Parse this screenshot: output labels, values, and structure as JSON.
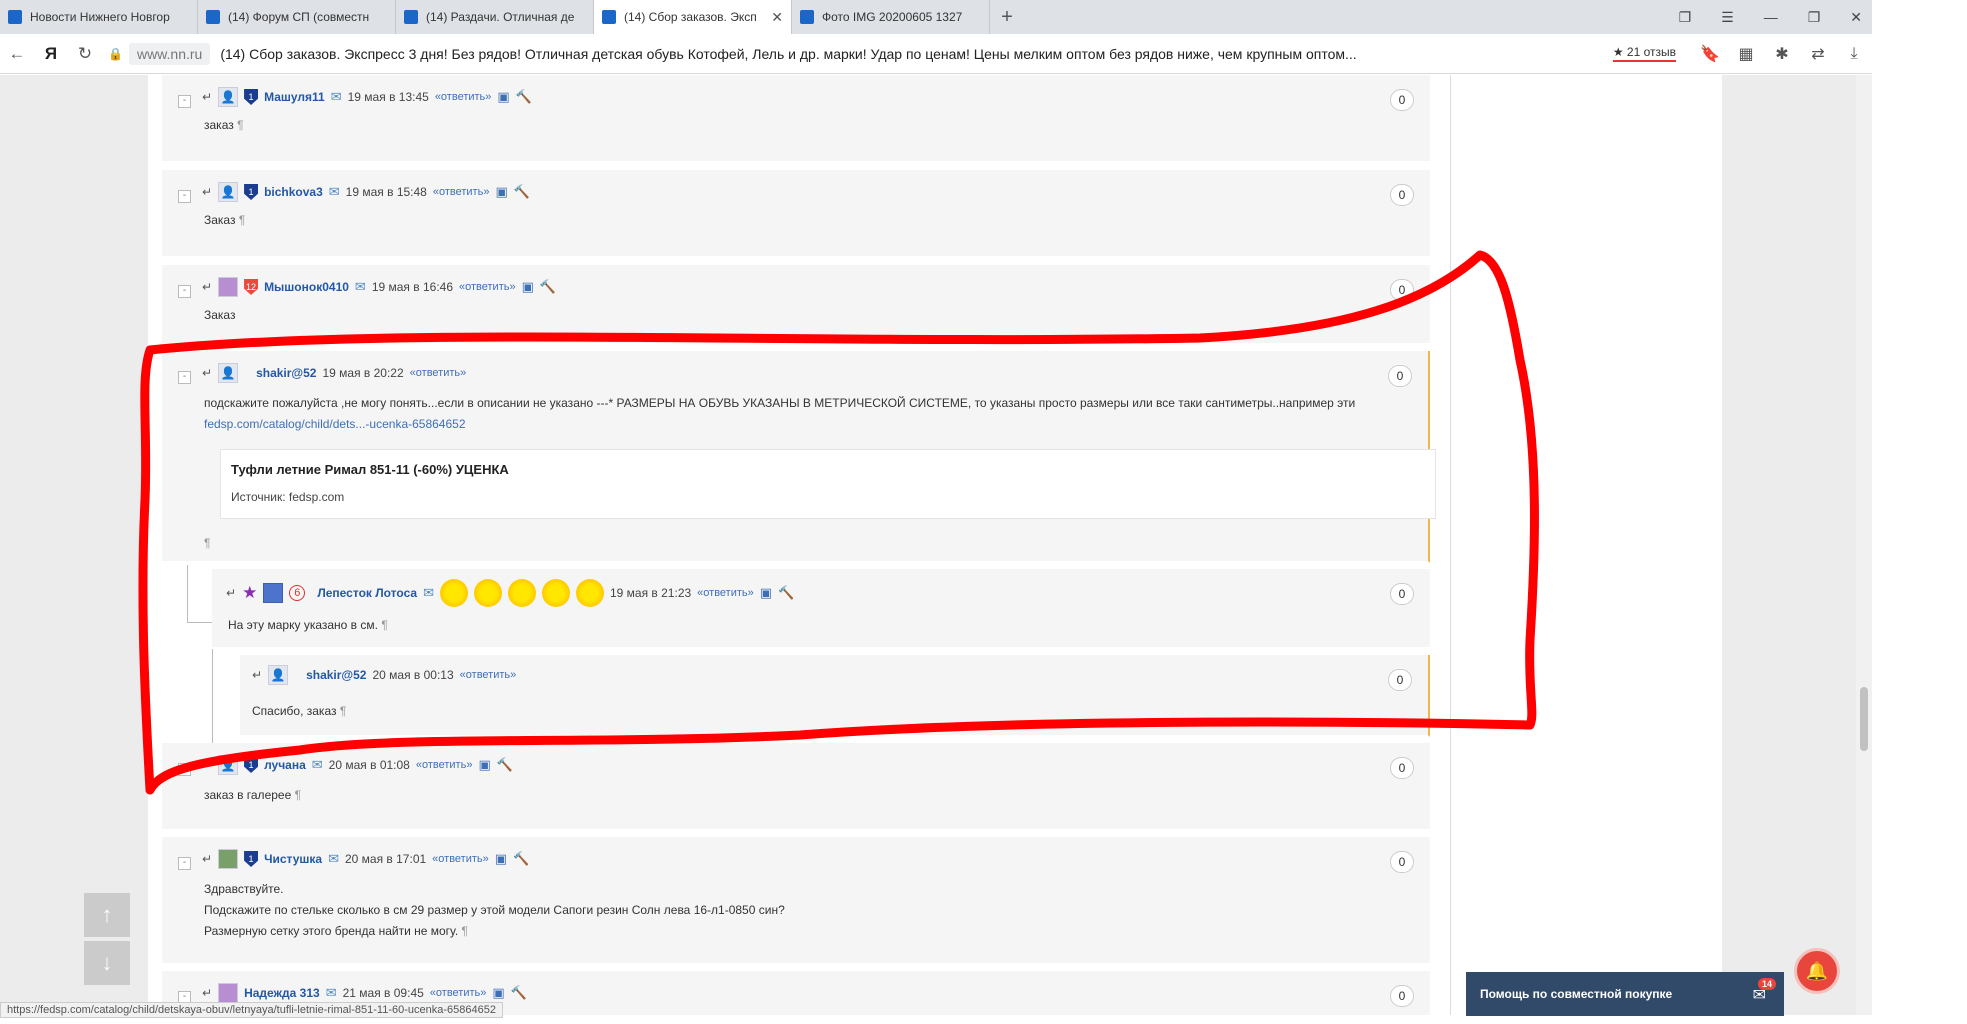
{
  "tabs": [
    {
      "title": "Новости Нижнего Новгор",
      "active": false
    },
    {
      "title": "(14) Форум СП (совместн",
      "active": false
    },
    {
      "title": "(14) Раздачи. Отличная де",
      "active": false
    },
    {
      "title": "(14) Сбор заказов. Эксп",
      "active": true
    },
    {
      "title": "Фото IMG 20200605 1327",
      "active": false
    }
  ],
  "address": {
    "domain": "www.nn.ru",
    "page_title": "(14) Сбор заказов. Экспресс 3 дня! Без рядов! Отличная детская обувь Котофей, Лель и др. марки! Удар по ценам! Цены мелким оптом без рядов ниже, чем крупным оптом...",
    "reviews": "21 отзыв"
  },
  "comments": [
    {
      "user": "Машуля11",
      "date": "19 мая в 13:45",
      "reply": "«ответить»",
      "text": "заказ",
      "votes": "0"
    },
    {
      "user": "bichkova3",
      "date": "19 мая в 15:48",
      "reply": "«ответить»",
      "text": "Заказ",
      "votes": "0"
    },
    {
      "user": "Мышонок0410",
      "date": "19 мая в 16:46",
      "reply": "«ответить»",
      "text": "Заказ",
      "votes": "0"
    },
    {
      "user": "shakir@52",
      "date": "19 мая в 20:22",
      "reply": "«ответить»",
      "text": "подскажите пожалуйста ,не могу понять...если в описании не указано ---* РАЗМЕРЫ НА ОБУВЬ УКАЗАНЫ В МЕТРИЧЕСКОЙ СИСТЕМЕ, то указаны просто размеры или все таки сантиметры..например эти",
      "link": "fedsp.com/catalog/child/dets...-ucenka-65864652",
      "preview_title": "Туфли летние Римал 851-11 (-60%) УЦЕНКА",
      "preview_source": "Источник: fedsp.com",
      "votes": "0"
    },
    {
      "user": "Лепесток Лотоса",
      "date": "19 мая в 21:23",
      "reply": "«ответить»",
      "rank": "6",
      "text": "На эту марку указано в см.",
      "votes": "0"
    },
    {
      "user": "shakir@52",
      "date": "20 мая в 00:13",
      "reply": "«ответить»",
      "text": "Спасибо, заказ",
      "votes": "0"
    },
    {
      "user": "лучана",
      "date": "20 мая в 01:08",
      "reply": "«ответить»",
      "text": "заказ в галерее",
      "votes": "0"
    },
    {
      "user": "Чистушка",
      "date": "20 мая в 17:01",
      "reply": "«ответить»",
      "text_lines": [
        "Здравствуйте.",
        "Подскажите по стельке сколько в см 29 размер у этой модели Сапоги резин Солн лева 16-л1-0850 син?",
        "Размерную сетку этого бренда найти не могу."
      ],
      "votes": "0"
    },
    {
      "user": "Надежда 313",
      "date": "21 мая в 09:45",
      "reply": "«ответить»",
      "votes": "0"
    }
  ],
  "pilcrow": "¶",
  "status_url": "https://fedsp.com/catalog/child/detskaya-obuv/letnyaya/tufli-letnie-rimal-851-11-60-ucenka-65864652",
  "help": {
    "label": "Помощь по совместной покупке",
    "count": "14"
  },
  "colors": {
    "accent_link": "#3d6fb8",
    "username": "#2358a6",
    "annotation_red": "#ff0000",
    "help_bg": "#314a69"
  }
}
